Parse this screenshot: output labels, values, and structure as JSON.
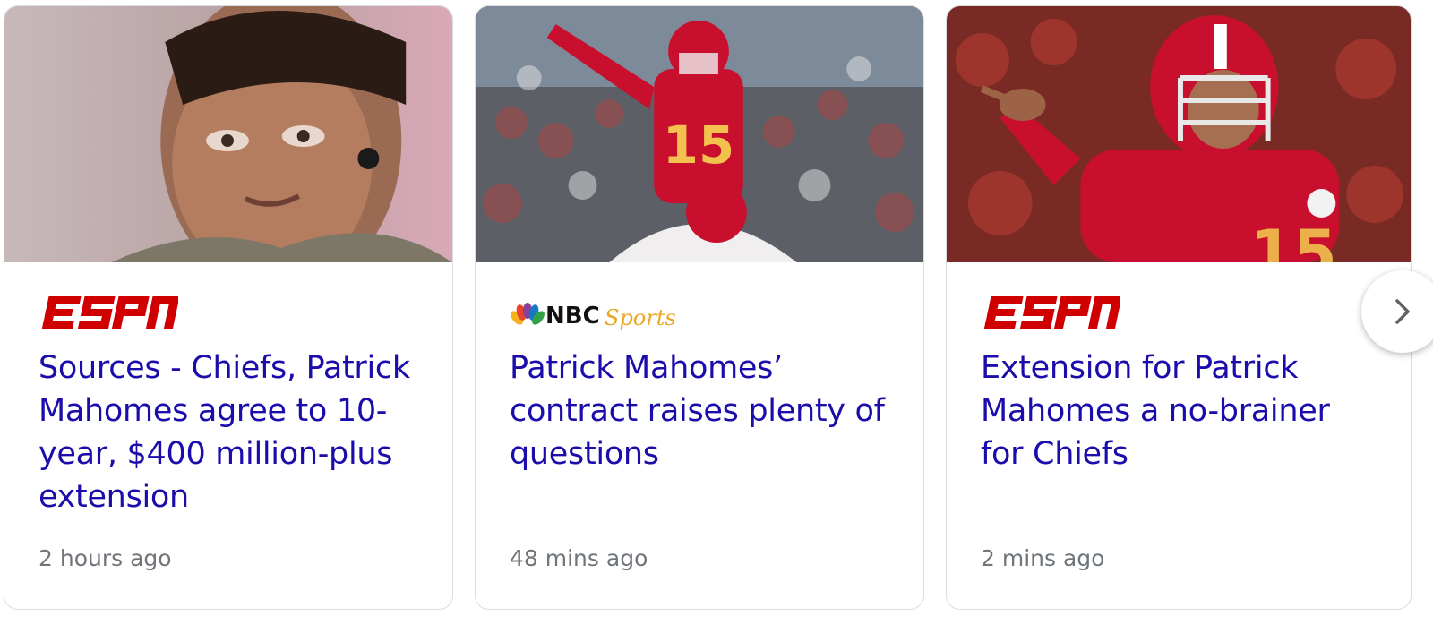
{
  "cards": [
    {
      "source": "ESPN",
      "source_logo_icon": "espn-logo",
      "headline": "Sources - Chiefs, Patrick Mahomes agree to 10-year, $400 million-plus extension",
      "time": "2 hours ago",
      "image_icon": "player-portrait-photo"
    },
    {
      "source": "NBC Sports",
      "source_logo_icon": "nbc-sports-logo",
      "logo_text_main": "NBC",
      "logo_text_script": "Sports",
      "headline": "Patrick Mahomes’ contract raises plenty of questions",
      "time": "48 mins ago",
      "image_icon": "quarterback-field-photo"
    },
    {
      "source": "ESPN",
      "source_logo_icon": "espn-logo",
      "headline": "Extension for Patrick Mahomes a no-brainer for Chiefs",
      "time": "2 mins ago",
      "image_icon": "quarterback-pointing-photo"
    }
  ],
  "colors": {
    "headline": "#1a0dab",
    "timestamp": "#70757a",
    "espn_red": "#d00000",
    "chiefs_red": "#c8102e"
  },
  "next_button_icon": "chevron-right-icon"
}
